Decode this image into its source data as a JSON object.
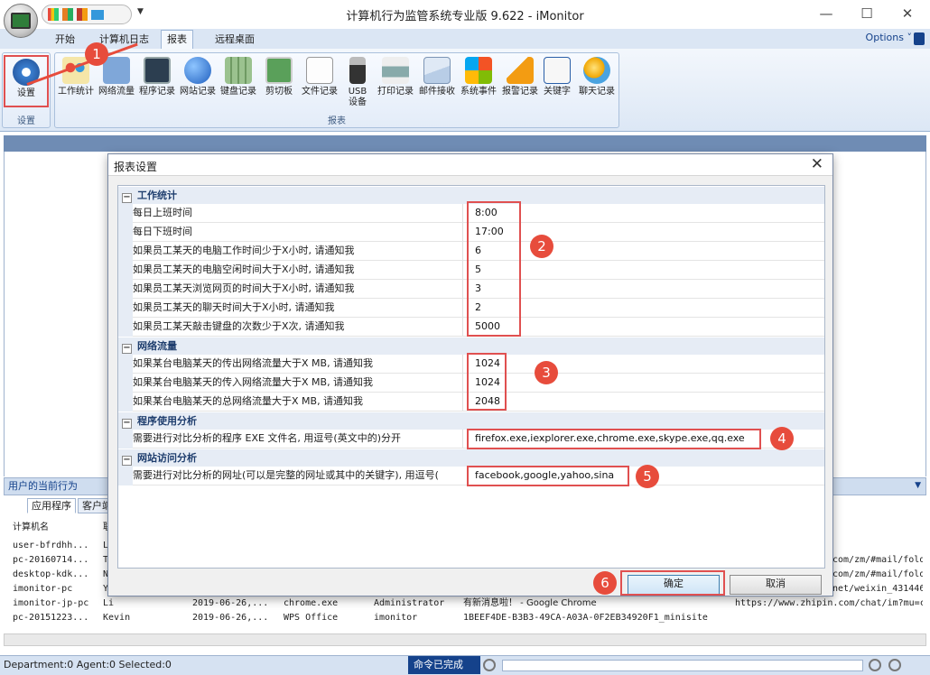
{
  "window": {
    "title": "计算机行为监管系统专业版 9.622 - iMonitor",
    "minimize": "—",
    "maximize": "☐",
    "close": "✕"
  },
  "tabs": [
    "开始",
    "计算机日志",
    "报表",
    "远程桌面"
  ],
  "options_label": "Options ˅",
  "ribbon": {
    "settings_group": "设置",
    "settings_button": "设置",
    "report_group": "报表",
    "buttons": [
      "工作统计",
      "网络流量",
      "程序记录",
      "网站记录",
      "键盘记录",
      "剪切板",
      "文件记录",
      "USB\n设备",
      "打印记录",
      "邮件接收",
      "系统事件",
      "报警记录",
      "关键字",
      "聊天记录"
    ]
  },
  "badges": [
    "1",
    "2",
    "3",
    "4",
    "5",
    "6"
  ],
  "bottom_panel": {
    "title": "用户的当前行为",
    "tabs": [
      "应用程序",
      "客户端"
    ],
    "header_col": "计算机名",
    "header_col2": "联",
    "rows": [
      {
        "c1": "user-bfrdhh...",
        "c2": "Le",
        "c3": "",
        "c4": "",
        "c5": "",
        "c6": "",
        "c7": "",
        "c8": ""
      },
      {
        "c1": "pc-20160714...",
        "c2": "Ti",
        "c3": "",
        "c4": "",
        "c5": "",
        "c6": "",
        "c7": "com/zm/#mail/fold",
        "c8": ""
      },
      {
        "c1": "desktop-kdk...",
        "c2": "Na",
        "c3": "",
        "c4": "",
        "c5": "",
        "c6": "",
        "c7": "com/zm/#mail/fold",
        "c8": ""
      },
      {
        "c1": "imonitor-pc",
        "c2": "Ya",
        "c3": "",
        "c4": "",
        "c5": "",
        "c6": "",
        "c7": "net/weixin_431446",
        "c8": ""
      },
      {
        "c1": "imonitor-jp-pc",
        "c2": "Li",
        "c3": "2019-06-26,...",
        "c4": "chrome.exe",
        "c5": "Administrator",
        "c6": "有新消息啦！ - Google Chrome",
        "c7": "https://www.zhipin.com/chat/im?mu=c",
        "c8": ""
      },
      {
        "c1": "pc-20151223...",
        "c2": "Kevin",
        "c3": "2019-06-26,...",
        "c4": "WPS Office",
        "c5": "imonitor",
        "c6": "1BEEF4DE-B3B3-49CA-A03A-0F2EB34920F1_minisite",
        "c7": "",
        "c8": ""
      }
    ]
  },
  "status": {
    "left": "Department:0  Agent:0  Selected:0",
    "center": "命令已完成"
  },
  "dialog": {
    "title": "报表设置",
    "close": "✕",
    "categories": [
      {
        "title": "工作统计",
        "toggle": "−"
      },
      {
        "title": "网络流量",
        "toggle": "−"
      },
      {
        "title": "程序使用分析",
        "toggle": "−"
      },
      {
        "title": "网站访问分析",
        "toggle": "−"
      }
    ],
    "work": [
      {
        "name": "每日上班时间",
        "value": "8:00"
      },
      {
        "name": "每日下班时间",
        "value": "17:00"
      },
      {
        "name": "如果员工某天的电脑工作时间少于X小时, 请通知我",
        "value": "6"
      },
      {
        "name": "如果员工某天的电脑空闲时间大于X小时, 请通知我",
        "value": "5"
      },
      {
        "name": "如果员工某天浏览网页的时间大于X小时, 请通知我",
        "value": "3"
      },
      {
        "name": "如果员工某天的聊天时间大于X小时, 请通知我",
        "value": "2"
      },
      {
        "name": "如果员工某天敲击键盘的次数少于X次, 请通知我",
        "value": "5000"
      }
    ],
    "network": [
      {
        "name": "如果某台电脑某天的传出网络流量大于X MB, 请通知我",
        "value": "1024"
      },
      {
        "name": "如果某台电脑某天的传入网络流量大于X MB, 请通知我",
        "value": "1024"
      },
      {
        "name": "如果某台电脑某天的总网络流量大于X MB, 请通知我",
        "value": "2048"
      }
    ],
    "program": {
      "name": "需要进行对比分析的程序 EXE 文件名, 用逗号(英文中的)分开",
      "value": "firefox.exe,iexplorer.exe,chrome.exe,skype.exe,qq.exe"
    },
    "website": {
      "name": "需要进行对比分析的网址(可以是完整的网址或其中的关键字), 用逗号(",
      "value": "facebook,google,yahoo,sina"
    },
    "ok": "确定",
    "cancel": "取消"
  }
}
